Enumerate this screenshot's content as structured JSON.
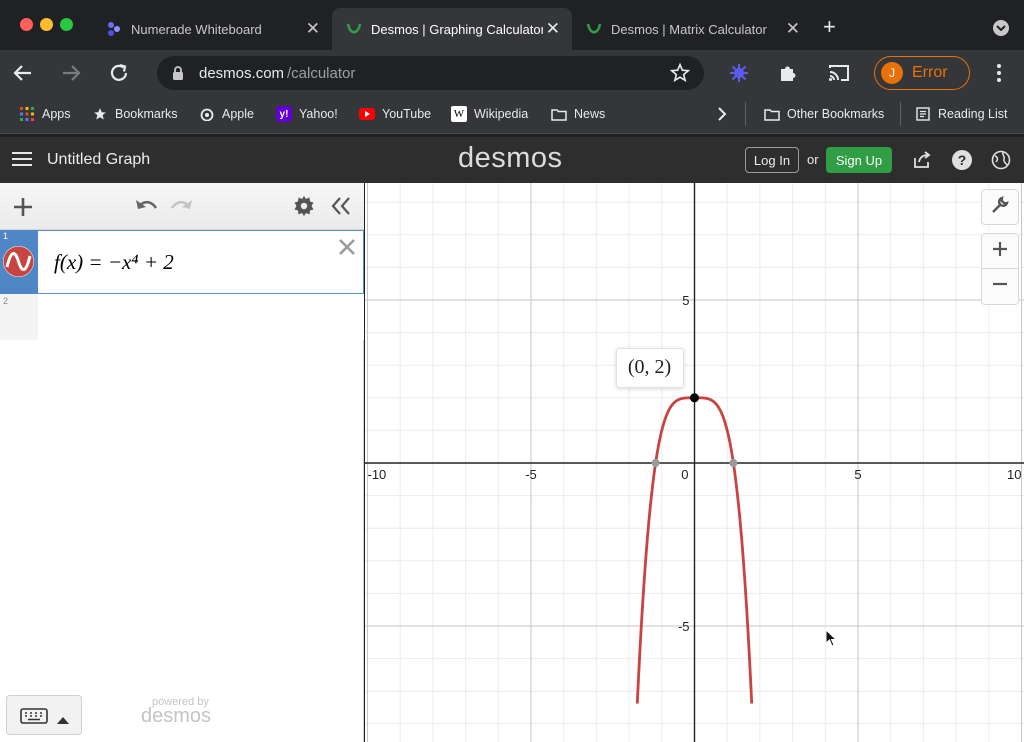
{
  "browser": {
    "tabs": [
      {
        "label": "Numerade Whiteboard",
        "active": false
      },
      {
        "label": "Desmos | Graphing Calculator",
        "active": true
      },
      {
        "label": "Desmos | Matrix Calculator",
        "active": false
      }
    ],
    "new_tab_label": "+",
    "url_host": "desmos.com",
    "url_path": "/calculator",
    "profile_initial": "J",
    "profile_status": "Error",
    "bookmarks": [
      {
        "label": "Apps",
        "icon": "apps-grid-icon"
      },
      {
        "label": "Bookmarks",
        "icon": "star-icon"
      },
      {
        "label": "Apple",
        "icon": "apple-icon"
      },
      {
        "label": "Yahoo!",
        "icon": "yahoo-icon"
      },
      {
        "label": "YouTube",
        "icon": "youtube-icon"
      },
      {
        "label": "Wikipedia",
        "icon": "wikipedia-icon"
      },
      {
        "label": "News",
        "icon": "folder-icon"
      }
    ],
    "other_bookmarks": "Other Bookmarks",
    "reading_list": "Reading List"
  },
  "desmos": {
    "graph_title": "Untitled Graph",
    "logo": "desmos",
    "login_label": "Log In",
    "or_label": "or",
    "signup_label": "Sign Up",
    "powered_by": "powered by",
    "powered_logo": "desmos"
  },
  "expressions": [
    {
      "index": "1",
      "latex_text": "f(x) = −x⁴ + 2",
      "color": "#c74440"
    },
    {
      "index": "2",
      "latex_text": ""
    }
  ],
  "graph": {
    "x_ticks": [
      {
        "value": -10,
        "label": "-10"
      },
      {
        "value": -5,
        "label": "-5"
      },
      {
        "value": 0,
        "label": "0"
      },
      {
        "value": 5,
        "label": "5"
      },
      {
        "value": 10,
        "label": "10"
      }
    ],
    "y_ticks": [
      {
        "value": 5,
        "label": "5"
      },
      {
        "value": -5,
        "label": "-5"
      }
    ],
    "curve_color": "#c74440",
    "point_label": "(0, 2)",
    "point": {
      "x": 0,
      "y": 2
    },
    "roots": [
      -1.189,
      1.189
    ]
  },
  "colors": {
    "accent_green": "#2f9e44",
    "error_orange": "#e8710a",
    "desmos_header": "#2e2e2e"
  }
}
